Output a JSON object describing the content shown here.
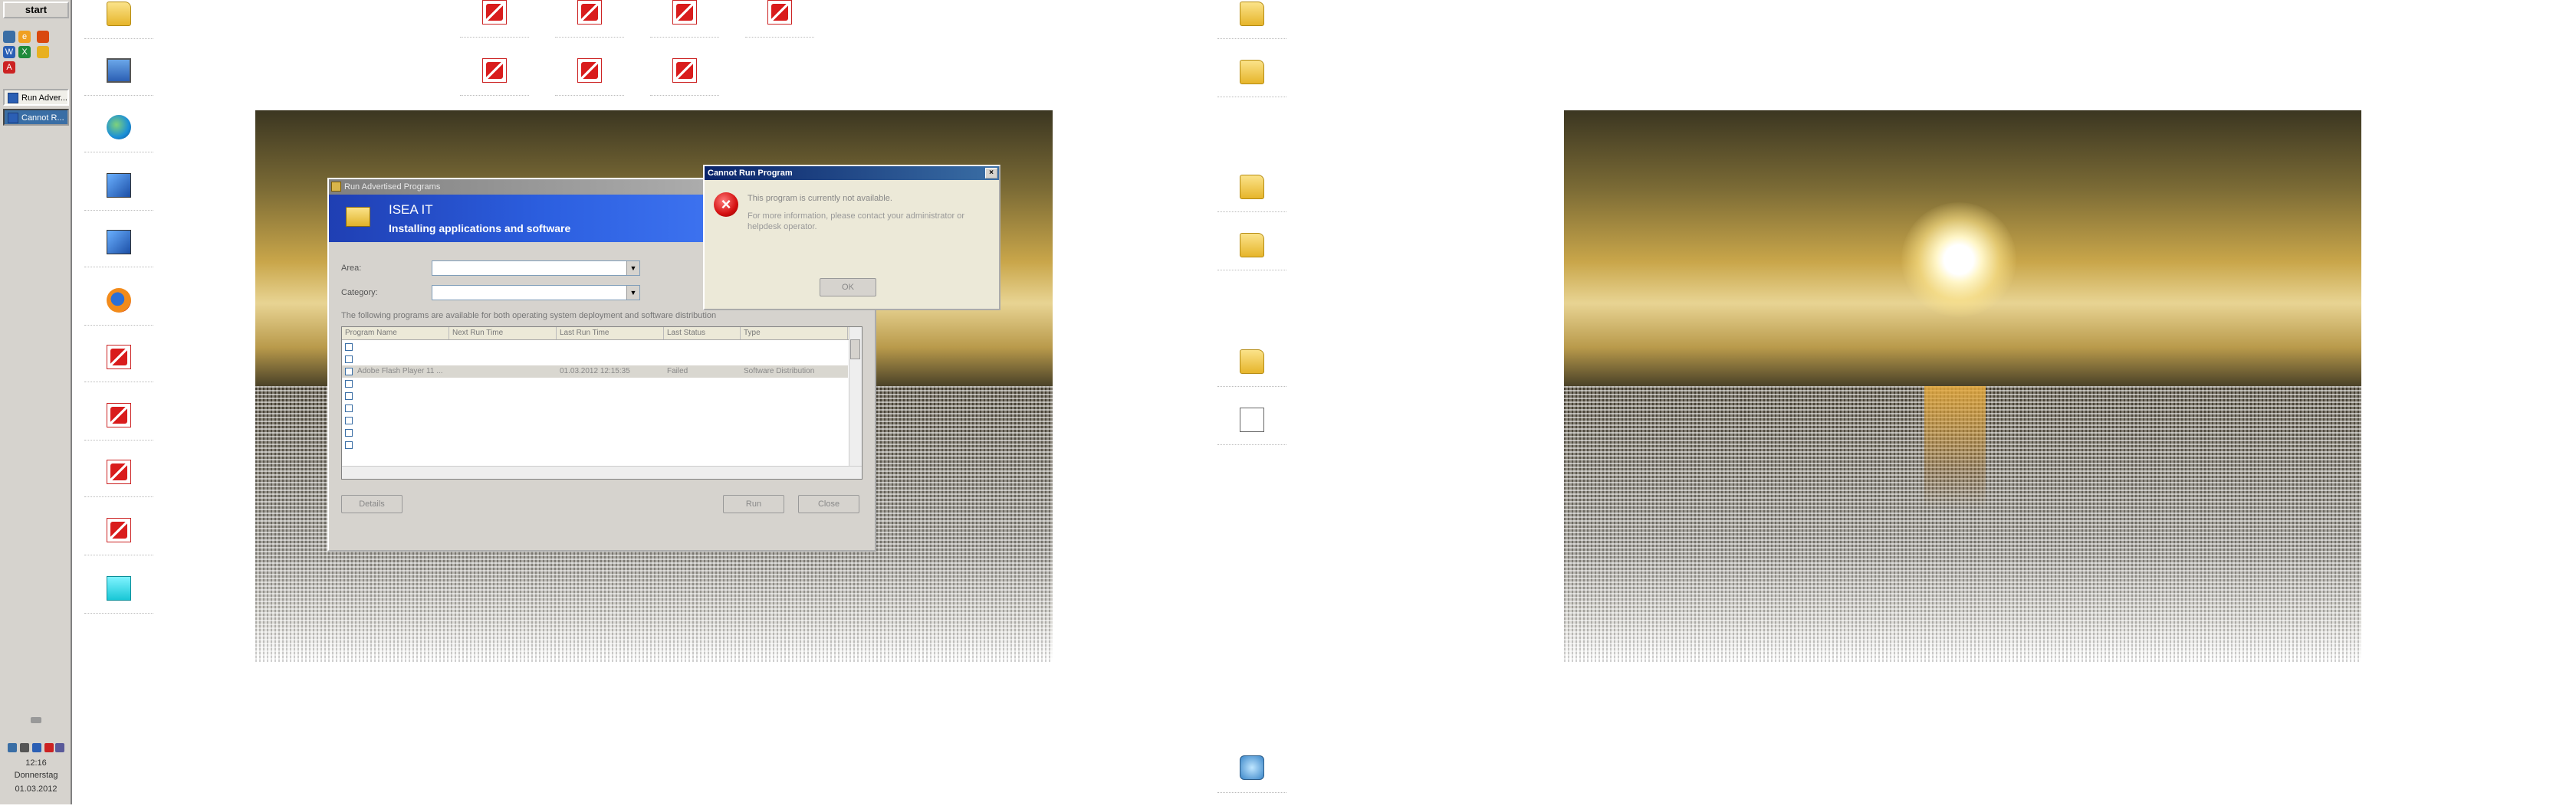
{
  "taskbar": {
    "start_label": "start",
    "tasks": [
      {
        "label": "Run Adver..."
      },
      {
        "label": "Cannot R..."
      }
    ],
    "tray": {
      "time": "12:16",
      "day": "Donnerstag",
      "date": "01.03.2012"
    }
  },
  "desktop_left": {
    "icons": [
      {
        "name": "folder-icon"
      },
      {
        "name": "monitor-icon"
      },
      {
        "name": "globe-icon"
      },
      {
        "name": "setup-icon"
      },
      {
        "name": "setup-icon"
      },
      {
        "name": "firefox-icon"
      },
      {
        "name": "pdf-icon"
      },
      {
        "name": "pdf-icon"
      },
      {
        "name": "pdf-icon"
      },
      {
        "name": "pdf-icon"
      },
      {
        "name": "cyan-icon"
      }
    ]
  },
  "run_advertised_programs": {
    "title": "Run Advertised Programs",
    "banner_title": "ISEA IT",
    "banner_subtitle": "Installing applications and software",
    "area_label": "Area:",
    "category_label": "Category:",
    "list_description": "The following programs are available for both operating system deployment and software distribution",
    "columns": [
      "Program Name",
      "Next Run Time",
      "Last Run Time",
      "Last Status",
      "Type"
    ],
    "rows": [
      {
        "name": "",
        "next": "",
        "last": "",
        "status": "",
        "type": ""
      },
      {
        "name": "",
        "next": "",
        "last": "",
        "status": "",
        "type": ""
      },
      {
        "name": "Adobe Flash Player 11 ...",
        "next": "",
        "last": "01.03.2012 12:15:35",
        "status": "Failed",
        "type": "Software Distribution"
      },
      {
        "name": "",
        "next": "",
        "last": "",
        "status": "",
        "type": ""
      },
      {
        "name": "",
        "next": "",
        "last": "",
        "status": "",
        "type": ""
      },
      {
        "name": "",
        "next": "",
        "last": "",
        "status": "",
        "type": ""
      },
      {
        "name": "",
        "next": "",
        "last": "",
        "status": "",
        "type": ""
      },
      {
        "name": "",
        "next": "",
        "last": "",
        "status": "",
        "type": ""
      },
      {
        "name": "",
        "next": "",
        "last": "",
        "status": "",
        "type": ""
      }
    ],
    "details_button": "Details",
    "run_button": "Run",
    "close_button": "Close"
  },
  "cannot_run_program": {
    "title": "Cannot Run Program",
    "message": "This program is currently not available.",
    "detail": "For more information, please contact your administrator or helpdesk operator.",
    "ok_button": "OK",
    "close_glyph": "×"
  },
  "colors": {
    "banner": "#2c5fe0",
    "dialog_title": "#0a246a",
    "error_red": "#d41010",
    "taskbar": "#d6d3ce"
  }
}
